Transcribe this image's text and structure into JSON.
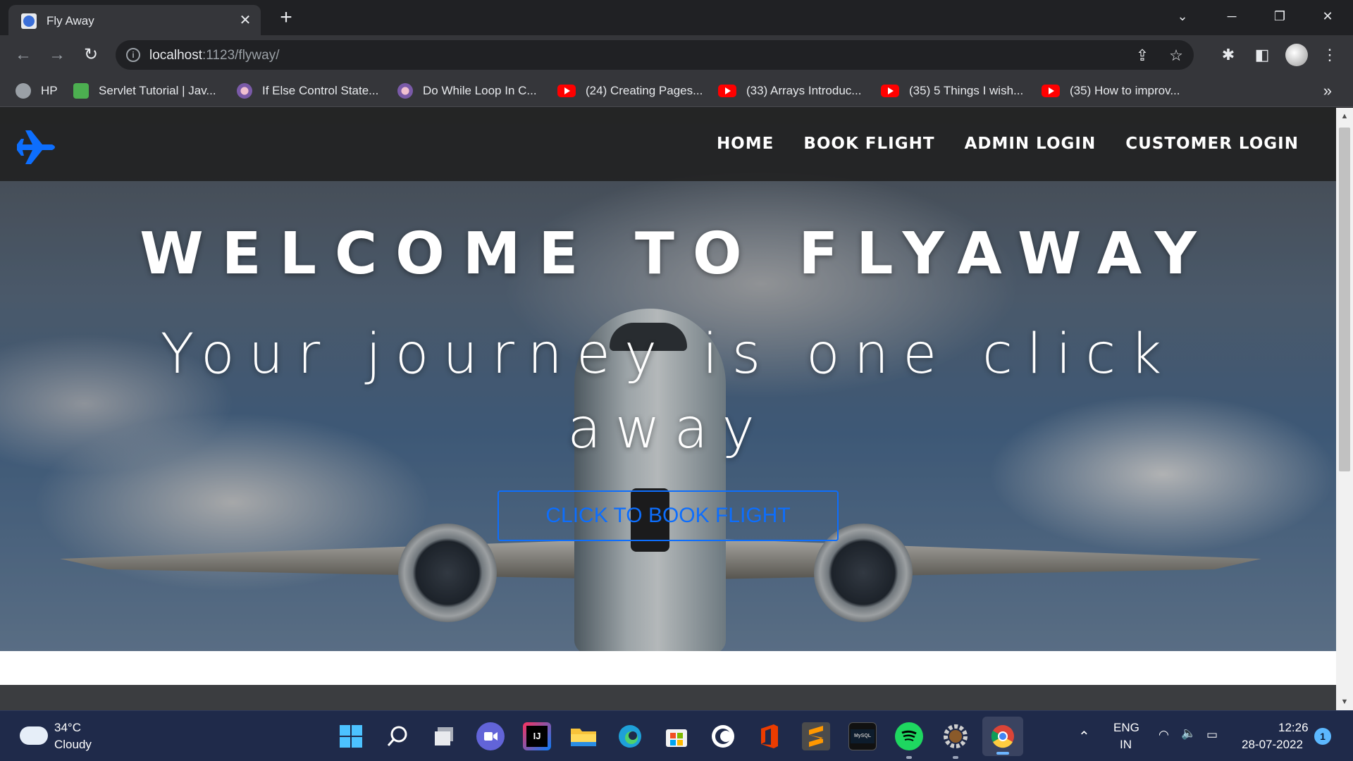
{
  "browser": {
    "tab_title": "Fly Away",
    "tab_close": "✕",
    "new_tab": "+",
    "url_host": "localhost",
    "url_path": ":1123/flyway/",
    "window_controls": [
      "⌄",
      "─",
      "❐",
      "✕"
    ],
    "bookmarks": [
      {
        "label": "HP",
        "icon": "globe-icon"
      },
      {
        "label": "Servlet Tutorial | Jav...",
        "icon": "servlet-icon"
      },
      {
        "label": "If Else Control State...",
        "icon": "person-avatar-icon"
      },
      {
        "label": "Do While Loop In C...",
        "icon": "person-avatar-icon"
      },
      {
        "label": "(24) Creating Pages...",
        "icon": "youtube-icon"
      },
      {
        "label": "(33) Arrays Introduc...",
        "icon": "youtube-icon"
      },
      {
        "label": "(35) 5 Things I wish...",
        "icon": "youtube-icon"
      },
      {
        "label": "(35) How to improv...",
        "icon": "youtube-icon"
      }
    ],
    "bookmarks_more": "»"
  },
  "site": {
    "nav": [
      "HOME",
      "BOOK FLIGHT",
      "ADMIN LOGIN",
      "CUSTOMER LOGIN"
    ],
    "hero_title": "WELCOME TO FLYAWAY",
    "hero_subtitle": "Your journey is one click away",
    "cta": "CLICK TO BOOK FLIGHT",
    "accent_color": "#0d6efd"
  },
  "taskbar": {
    "weather_temp": "34°C",
    "weather_desc": "Cloudy",
    "apps": [
      "start-icon",
      "search-icon",
      "task-view-icon",
      "teams-chat-icon",
      "intellij-icon",
      "file-explorer-icon",
      "edge-icon",
      "microsoft-store-icon",
      "eclipse-icon",
      "office-icon",
      "sublime-text-icon",
      "mysql-icon",
      "spotify-icon",
      "settings-icon",
      "chrome-icon"
    ],
    "lang": "ENG",
    "region": "IN",
    "time": "12:26",
    "date": "28-07-2022",
    "notifications": "1"
  }
}
